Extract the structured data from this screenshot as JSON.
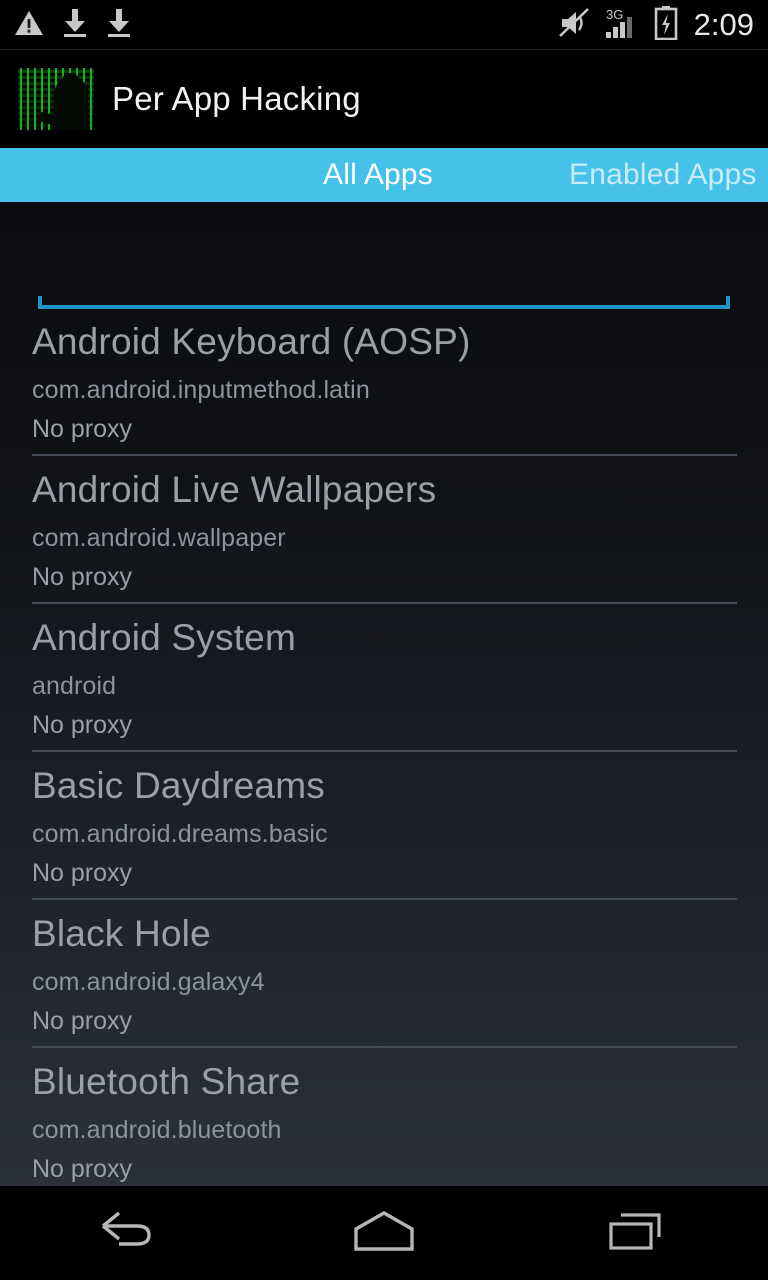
{
  "statusbar": {
    "icons": [
      "warning-triangle-icon",
      "download-icon",
      "download-icon"
    ],
    "right_icons": [
      "volume-muted-icon",
      "signal-3g-icon",
      "battery-charging-icon"
    ],
    "network_label": "3G",
    "time": "2:09"
  },
  "actionbar": {
    "app_icon": "matrix-hacker-icon",
    "title": "Per App Hacking"
  },
  "tabs": {
    "accent_color": "#45c1ea",
    "active_color": "#ffffff",
    "inactive_color": "#c9ecf8",
    "items": [
      {
        "label": "All Apps",
        "active": true
      },
      {
        "label": "Enabled Apps",
        "active": false
      }
    ]
  },
  "search": {
    "value": "",
    "placeholder": "",
    "underline_color": "#1f92c8"
  },
  "app_list": [
    {
      "name": "Android Keyboard (AOSP)",
      "package": "com.android.inputmethod.latin",
      "status": "No proxy"
    },
    {
      "name": "Android Live Wallpapers",
      "package": "com.android.wallpaper",
      "status": "No proxy"
    },
    {
      "name": "Android System",
      "package": "android",
      "status": "No proxy"
    },
    {
      "name": "Basic Daydreams",
      "package": "com.android.dreams.basic",
      "status": "No proxy"
    },
    {
      "name": "Black Hole",
      "package": "com.android.galaxy4",
      "status": "No proxy"
    },
    {
      "name": "Bluetooth Share",
      "package": "com.android.bluetooth",
      "status": "No proxy"
    }
  ],
  "navbar": {
    "buttons": [
      {
        "name": "back-icon"
      },
      {
        "name": "home-icon"
      },
      {
        "name": "recents-icon"
      }
    ]
  }
}
